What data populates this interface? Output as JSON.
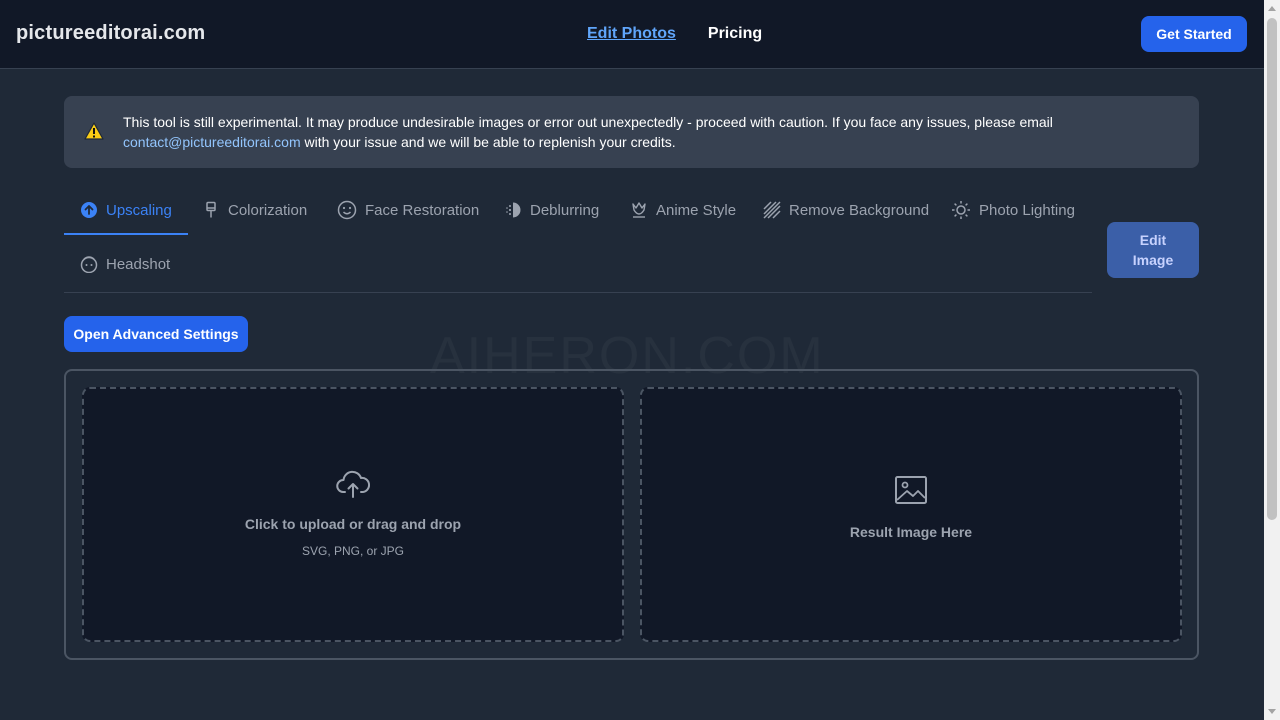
{
  "header": {
    "logo": "pictureeditorai.com",
    "nav": [
      {
        "label": "Edit Photos",
        "active": true
      },
      {
        "label": "Pricing",
        "active": false
      }
    ],
    "cta_label": "Get Started"
  },
  "alert": {
    "icon": "warning-icon",
    "message": "This tool is still experimental. It may produce undesirable images or error out unexpectedly - proceed with caution. If you face any issues, please email",
    "email": "contact@pictureeditorai.com",
    "message_after": " with your issue and we will be able to replenish your credits."
  },
  "tabs": [
    {
      "label": "Upscaling",
      "icon": "arrow-up-circle-icon",
      "active": true
    },
    {
      "label": "Colorization",
      "icon": "paintbrush-icon",
      "active": false
    },
    {
      "label": "Face Restoration",
      "icon": "smiley-face-icon",
      "active": false
    },
    {
      "label": "Deblurring",
      "icon": "blur-icon",
      "active": false
    },
    {
      "label": "Anime Style",
      "icon": "anime-icon",
      "active": false
    },
    {
      "label": "Remove Background",
      "icon": "stripes-icon",
      "active": false
    },
    {
      "label": "Photo Lighting",
      "icon": "sun-icon",
      "active": false
    },
    {
      "label": "Headshot",
      "icon": "headshot-icon",
      "active": false
    }
  ],
  "edit_button": {
    "line1": "Edit",
    "line2": "Image"
  },
  "advanced_button": "Open Advanced Settings",
  "watermark": "AIHERON.COM",
  "upload": {
    "icon": "cloud-upload-icon",
    "title": "Click to upload or drag and drop",
    "subtitle": "SVG, PNG, or JPG"
  },
  "result": {
    "icon": "image-placeholder-icon",
    "title": "Result Image Here"
  },
  "colors": {
    "accent": "#2563eb",
    "background": "#1f2937",
    "header": "#111827"
  }
}
